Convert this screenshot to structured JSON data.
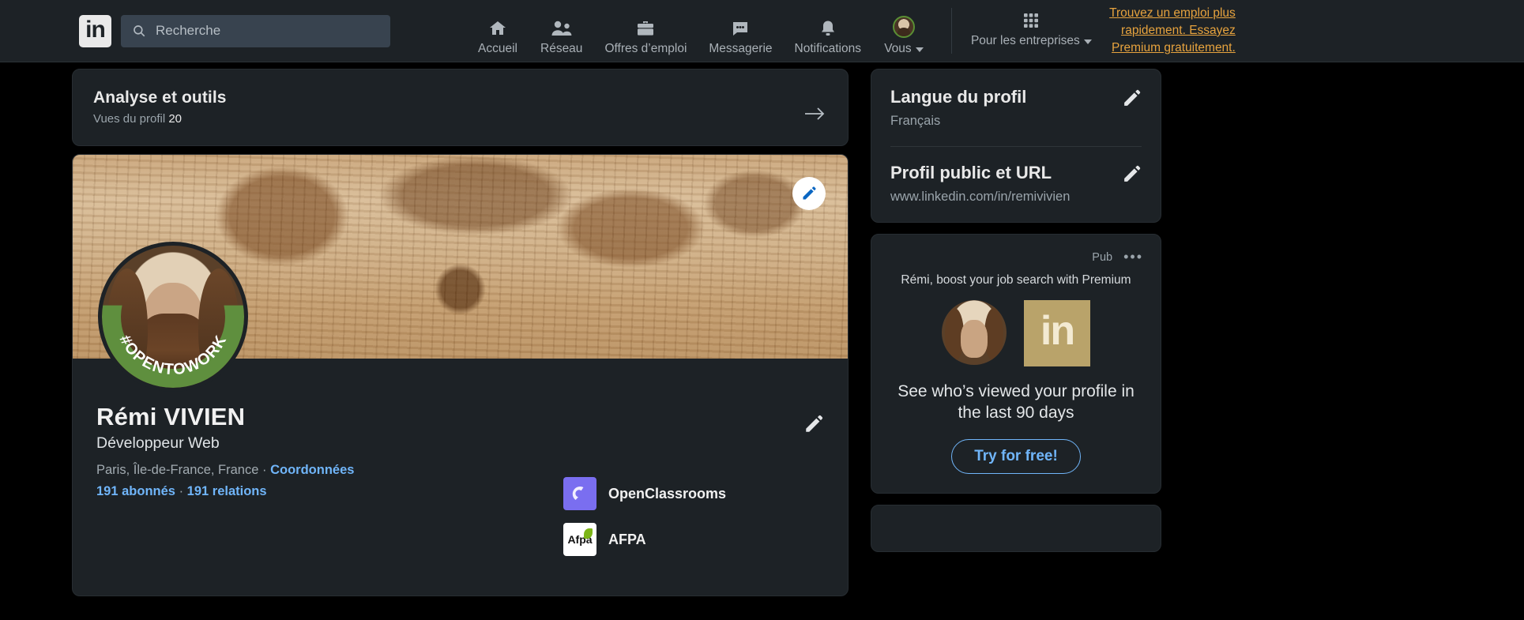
{
  "topnav": {
    "logo_text": "in",
    "logo_icon": "linkedin-logo",
    "search": {
      "placeholder": "Recherche",
      "icon": "search-icon"
    },
    "items": [
      {
        "label": "Accueil",
        "icon": "home-icon"
      },
      {
        "label": "Réseau",
        "icon": "network-people-icon"
      },
      {
        "label": "Offres d’emploi",
        "icon": "briefcase-icon"
      },
      {
        "label": "Messagerie",
        "icon": "message-bubble-icon"
      },
      {
        "label": "Notifications",
        "icon": "bell-icon"
      },
      {
        "label": "Vous",
        "icon": "user-avatar-icon"
      }
    ],
    "business": {
      "label": "Pour les entreprises",
      "icon": "grid-apps-icon"
    },
    "promo": "Trouvez un emploi plus rapidement. Essayez Premium gratuitement."
  },
  "analytics": {
    "title": "Analyse et outils",
    "metric_label": "Vues du profil",
    "metric_value": "20",
    "arrow_icon": "arrow-right-icon"
  },
  "profile": {
    "edit_banner_icon": "pencil-icon",
    "edit_profile_icon": "pencil-icon",
    "open_to_work_badge": "#OPENTOWORK",
    "name": "Rémi VIVIEN",
    "headline": "Développeur Web",
    "location": "Paris, Île-de-France, France",
    "separator": "·",
    "contact_link": "Coordonnées",
    "followers": "191 abonnés",
    "connections": "191 relations",
    "orgs": [
      {
        "name": "OpenClassrooms",
        "logo": "openclassrooms-logo",
        "color": "#7a6ef0"
      },
      {
        "name": "AFPA",
        "logo": "afpa-logo",
        "color": "#ffffff"
      }
    ]
  },
  "sidebar": {
    "language": {
      "heading": "Langue du profil",
      "value": "Français",
      "edit_icon": "pencil-icon"
    },
    "public_url": {
      "heading": "Profil public et URL",
      "value": "www.linkedin.com/in/remivivien",
      "edit_icon": "pencil-icon"
    },
    "ad": {
      "label": "Pub",
      "more_icon": "ellipsis-icon",
      "headline": "Rémi, boost your job search with Premium",
      "avatar_icon": "user-avatar-icon",
      "brand_icon": "linkedin-gold-icon",
      "brand_text": "in",
      "body": "See who’s viewed your profile in the last 90 days",
      "cta": "Try for free!"
    }
  },
  "colors": {
    "background": "#000000",
    "card": "#1d2226",
    "nav": "#1d2226",
    "accent_blue": "#70b5f9",
    "promo_gold": "#e7a33e",
    "open_to_work_green": "#5f8f3e",
    "openclassrooms_purple": "#7a6ef0",
    "linkedin_gold": "#b9a36a"
  }
}
